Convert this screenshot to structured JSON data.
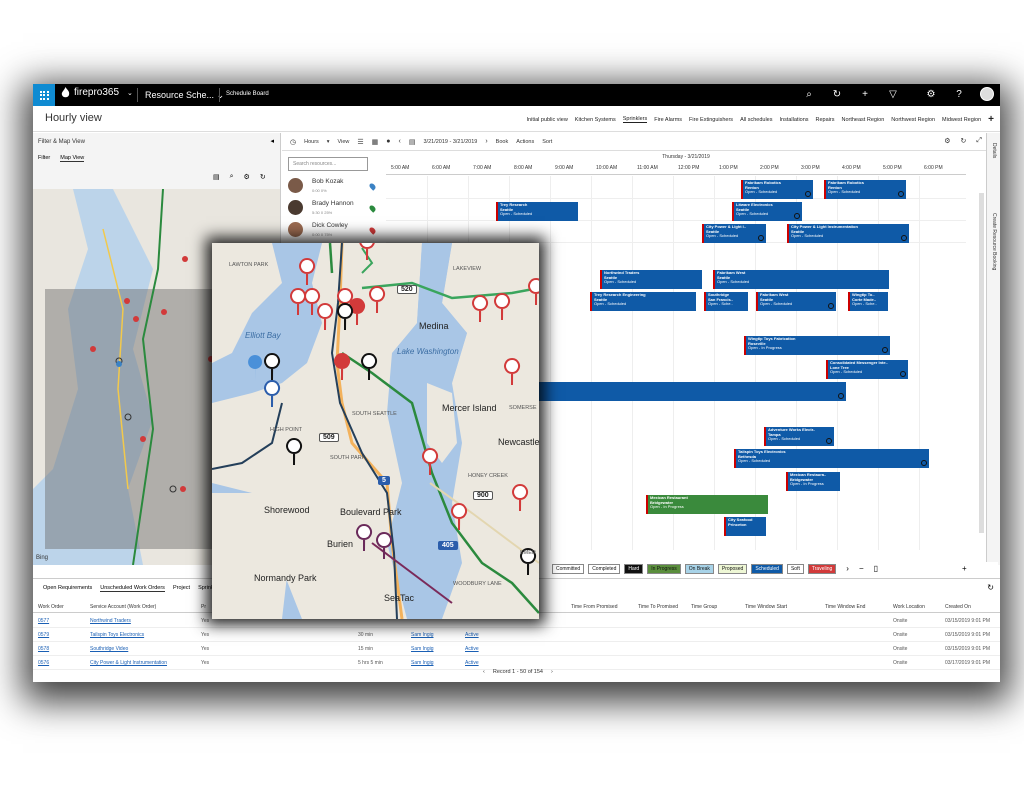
{
  "topbar": {
    "brand": "firepro365",
    "module": "Resource Sche...",
    "breadcrumb": "Schedule Board"
  },
  "page": {
    "title": "Hourly view",
    "tabs": [
      "Initial public view",
      "Kitchen Systems",
      "Sprinklers",
      "Fire Alarms",
      "Fire Extinguishers",
      "All schedules",
      "Installations",
      "Repairs",
      "Northeast Region",
      "Northwest Region",
      "Midwest Region"
    ],
    "active_tab": "Sprinklers"
  },
  "left_panel": {
    "title": "Filter & Map View",
    "tabs": [
      "Filter",
      "Map View"
    ],
    "map_type": [
      "Gray",
      "Road"
    ],
    "bing_label": "Bing"
  },
  "board": {
    "hours_label": "Hours",
    "view_label": "View",
    "date_range": "3/21/2019 - 3/21/2019",
    "book_label": "Book",
    "actions_label": "Actions",
    "sort_label": "Sort",
    "search_placeholder": "Search resources...",
    "date_heading": "Thursday - 3/21/2019",
    "hours": [
      "5:00 AM",
      "6:00 AM",
      "7:00 AM",
      "8:00 AM",
      "9:00 AM",
      "10:00 AM",
      "11:00 AM",
      "12:00 PM",
      "1:00 PM",
      "2:00 PM",
      "3:00 PM",
      "4:00 PM",
      "5:00 PM",
      "6:00 PM"
    ],
    "resources": [
      {
        "name": "Bob Kozak",
        "sub": "0:00 0%"
      },
      {
        "name": "Brady Hannon",
        "sub": "5:30 0 25%"
      },
      {
        "name": "Dick Cowley",
        "sub": "0:00 0 75%"
      }
    ],
    "bookings": [
      {
        "title": "Fabrikam Robotics",
        "line2": "Renton",
        "status": "Open - Scheduled"
      },
      {
        "title": "Fabrikam Robotics",
        "line2": "Renton",
        "status": "Open - Scheduled"
      },
      {
        "title": "Trey Research",
        "line2": "Seattle",
        "status": "Open - Scheduled"
      },
      {
        "title": "Litware Electronics",
        "line2": "Seattle",
        "status": "Open - Scheduled"
      },
      {
        "title": "City Power & Light I..",
        "line2": "Seattle",
        "status": "Open - Scheduled"
      },
      {
        "title": "City Power & Light Instrumentation",
        "line2": "Seattle",
        "status": "Open - Scheduled"
      },
      {
        "title": "Northwind Traders",
        "line2": "Seattle",
        "status": "Open - Scheduled"
      },
      {
        "title": "Fabrikam West",
        "line2": "Seattle",
        "status": "Open - Scheduled"
      },
      {
        "title": "Trey Research Engineering",
        "line2": "Seattle",
        "status": "Open - Scheduled"
      },
      {
        "title": "Southridge",
        "line2": "San Francis..",
        "status": "Open - Sche.."
      },
      {
        "title": "Fabrikam West",
        "line2": "Seattle",
        "status": "Open - Scheduled"
      },
      {
        "title": "Wingtip To..",
        "line2": "Corte Made..",
        "status": "Open - Sche.."
      },
      {
        "title": "Wingtip Toys Fabrication",
        "line2": "Roseville",
        "status": "Open - In Progress"
      },
      {
        "title": "Consolidated Messenger Inte..",
        "line2": "Lone Tree",
        "status": "Open - Scheduled"
      },
      {
        "title": "Adventure Works Electr..",
        "line2": "Tampa",
        "status": "Open - Scheduled"
      },
      {
        "title": "Tailspin Toys Electronics",
        "line2": "Bethesda",
        "status": "Open - Scheduled"
      },
      {
        "title": "Mexican Restaura..",
        "line2": "Bridgewater",
        "status": "Open - In Progress"
      },
      {
        "title": "Mexican Restaurant",
        "line2": "Bridgewater",
        "status": "Open - In Progress"
      },
      {
        "title": "City Seafood",
        "line2": "Princeton",
        "status": ""
      }
    ]
  },
  "legend": [
    "Committed",
    "Completed",
    "Hard",
    "In Progress",
    "On Break",
    "Proposed",
    "Scheduled",
    "Soft",
    "Traveling"
  ],
  "details_labels": [
    "Details",
    "Create Resource Booking"
  ],
  "bottom": {
    "tabs": [
      "Open Requirements",
      "Unscheduled Work Orders",
      "Project",
      "Sprinkler"
    ],
    "active_tab": "Unscheduled Work Orders",
    "headers": [
      "Work Order",
      "Service Account (Work Order)",
      "Pr",
      "Time From Promised",
      "Time To Promised",
      "Time Group",
      "Time Window Start",
      "Time Window End",
      "Work Location",
      "Created On"
    ],
    "rows": [
      {
        "wo": "0577",
        "account": "Northwind Traders",
        "flag": "Yes",
        "dur": "",
        "owner": "",
        "status": "",
        "location": "Onsite",
        "created": "03/15/2019 9:01 PM"
      },
      {
        "wo": "0579",
        "account": "Tailspin Toys Electronics",
        "flag": "Yes",
        "dur": "30 min",
        "owner": "Sam Ingig",
        "status": "Active",
        "location": "Onsite",
        "created": "03/15/2019 9:01 PM"
      },
      {
        "wo": "0578",
        "account": "Southridge Video",
        "flag": "Yes",
        "dur": "15 min",
        "owner": "Sam Ingig",
        "status": "Active",
        "location": "Onsite",
        "created": "03/15/2019 9:01 PM"
      },
      {
        "wo": "0576",
        "account": "City Power & Light Instrumentation",
        "flag": "Yes",
        "dur": "5 hrs 5 min",
        "owner": "Sam Ingig",
        "status": "Active",
        "location": "Onsite",
        "created": "03/17/2019 9:01 PM"
      }
    ],
    "pager": "Record 1 - 50 of 154"
  },
  "map": {
    "places": [
      "LAWTON PARK",
      "LAKEVIEW",
      "Elliott Bay",
      "Medina",
      "Lake Washington",
      "SOUTH SEATTLE",
      "HIGH POINT",
      "SOUTH PARK",
      "Mercer Island",
      "SOMERSE",
      "Newcastle",
      "HONEY CREEK",
      "Shorewood",
      "Boulevard Park",
      "Burien",
      "Normandy Park",
      "WOODBURY LANE",
      "SeaTac",
      "EMER"
    ],
    "routes": [
      "520",
      "509",
      "5",
      "900",
      "405"
    ]
  }
}
